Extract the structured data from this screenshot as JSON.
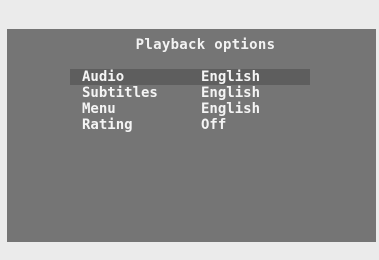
{
  "menu": {
    "title": "Playback options",
    "items": [
      {
        "label": "Audio",
        "value": "English"
      },
      {
        "label": "Subtitles",
        "value": "English"
      },
      {
        "label": "Menu",
        "value": "English"
      },
      {
        "label": "Rating",
        "value": "Off"
      }
    ],
    "selected_index": 0
  },
  "colors": {
    "screen_background": "#757575",
    "highlight": "#5e5e5e",
    "text": "#f4f4f4",
    "outer_background": "#ebebeb"
  }
}
